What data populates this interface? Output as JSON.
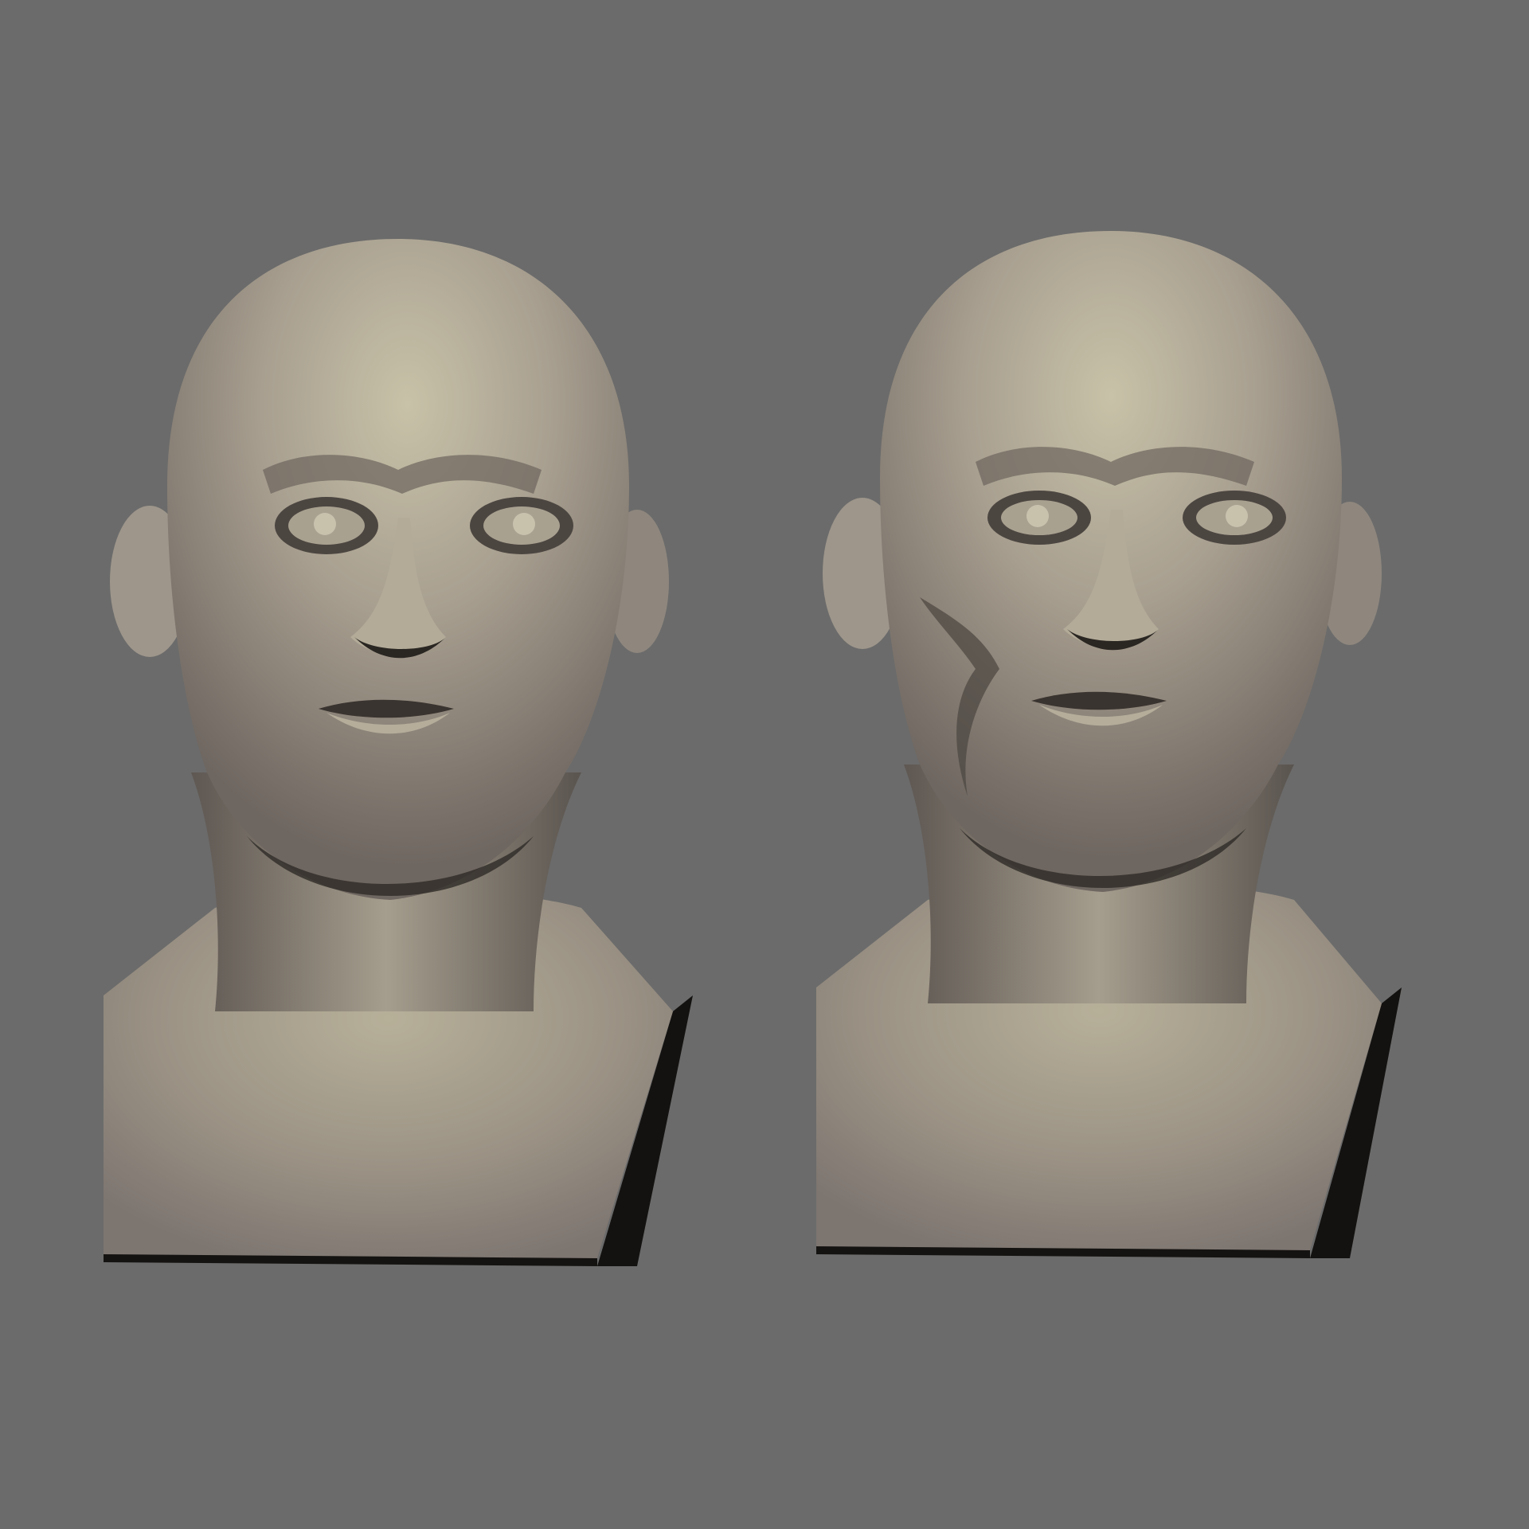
{
  "scene": {
    "background_color": "#6b6b6b",
    "material_color": "#a59c8f",
    "highlight_color": "#c9c3a7",
    "shadow_color": "#1a1816",
    "busts": [
      {
        "name": "bust-left",
        "variant": "smooth-face"
      },
      {
        "name": "bust-right",
        "variant": "asymmetric-cheek-crease"
      }
    ]
  }
}
